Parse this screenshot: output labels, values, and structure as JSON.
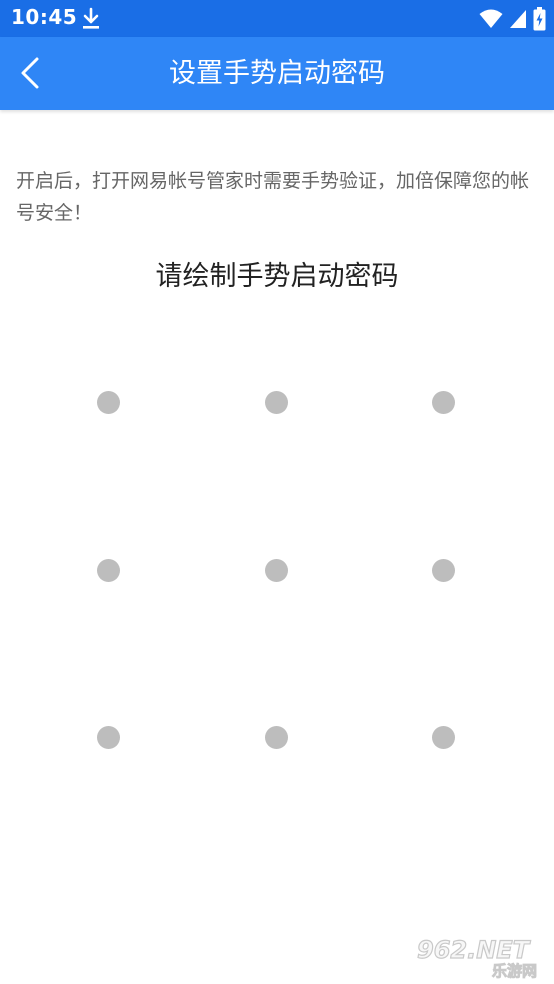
{
  "status_bar": {
    "time": "10:45",
    "bg_color": "#1a6ee6"
  },
  "app_bar": {
    "title": "设置手势启动密码",
    "back_icon": "chevron-left-icon",
    "bg_color": "#2f86f6"
  },
  "description": "开启后，打开网易帐号管家时需要手势验证，加倍保障您的帐号安全！",
  "prompt": "请绘制手势启动密码",
  "gesture_grid": {
    "rows": 3,
    "cols": 3,
    "dot_color": "#bdbdbd"
  },
  "watermark": {
    "line1": "962.NET",
    "line2": "乐游网"
  }
}
